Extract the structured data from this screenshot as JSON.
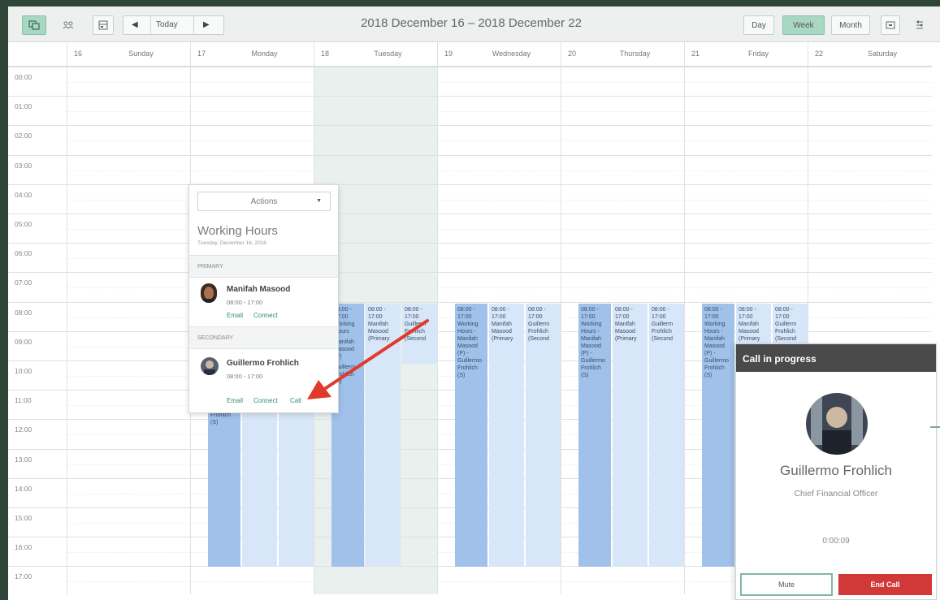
{
  "toolbar": {
    "today_label": "Today",
    "range_title": "2018 December 16 – 2018 December 22",
    "view_day": "Day",
    "view_week": "Week",
    "view_month": "Month",
    "active_view": "Week",
    "icons": [
      "calendar-icon",
      "people-icon",
      "schedule-icon",
      "prev-arrow-icon",
      "next-arrow-icon",
      "print-icon",
      "settings-icon"
    ]
  },
  "days": [
    {
      "num": "16",
      "name": "Sunday"
    },
    {
      "num": "17",
      "name": "Monday"
    },
    {
      "num": "18",
      "name": "Tuesday"
    },
    {
      "num": "19",
      "name": "Wednesday"
    },
    {
      "num": "20",
      "name": "Thursday"
    },
    {
      "num": "21",
      "name": "Friday"
    },
    {
      "num": "22",
      "name": "Saturday"
    }
  ],
  "hours": [
    "00:00",
    "01:00",
    "02:00",
    "03:00",
    "04:00",
    "05:00",
    "06:00",
    "07:00",
    "08:00",
    "09:00",
    "10:00",
    "11:00",
    "12:00",
    "13:00",
    "14:00",
    "15:00",
    "16:00",
    "17:00"
  ],
  "events": {
    "working": "08:00 - 17:00 Working Hours - Manifah Masood (P) - Guillermo Frohlich (S)",
    "manifah": "08:00 - 17:00 Manifah Masood (Primary",
    "guillermo": "08:00 - 17:00 Guillerm Frohlich (Second",
    "monday_tail": "Frohlich (S)",
    "tuesday_tail_a": "Manifah Masood (P)",
    "tuesday_tail_b": "Guillerm Frohlich (S)",
    "tue_working": "08:00 - 17:00 Working Hours",
    "tue_manifah": "08:00 - 17:00 Manifah Masood (Primary",
    "tue_guillermo": "08:00 - 17:00 Guillerm Frohlich (Second"
  },
  "popover": {
    "actions_label": "Actions",
    "title": "Working Hours",
    "date": "Tuesday, December 16, 2018",
    "primary_label": "PRIMARY",
    "secondary_label": "SECONDARY",
    "primary": {
      "name": "Manifah Masood",
      "time": "08:00 - 17:00",
      "email": "Email",
      "connect": "Connect"
    },
    "secondary": {
      "name": "Guillermo Frohlich",
      "time": "08:00 - 17:00",
      "email": "Email",
      "connect": "Connect",
      "call": "Call"
    }
  },
  "call": {
    "header": "Call in progress",
    "name": "Guillermo Frohlich",
    "role": "Chief Financial Officer",
    "timer": "0:00:09",
    "mute_label": "Mute",
    "end_label": "End Call"
  },
  "colors": {
    "accent": "#a8d8c4",
    "event_dark": "#9fc1ea",
    "event_light": "#d7e6f8",
    "end_call": "#d23838",
    "annotation_arrow": "#e03a2a"
  }
}
